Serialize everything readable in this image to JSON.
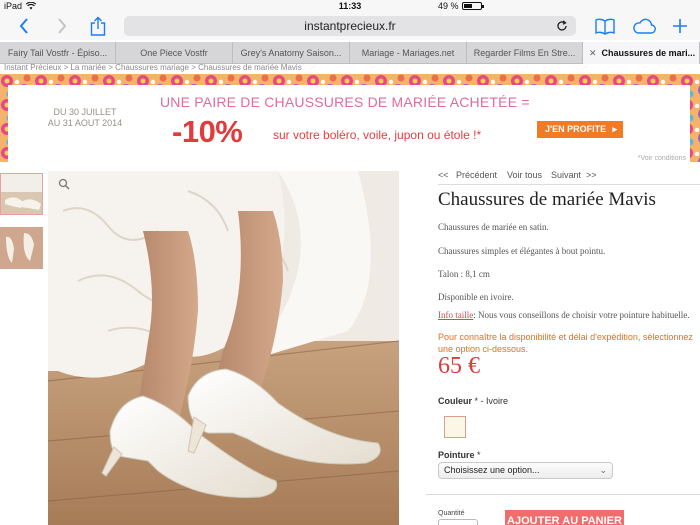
{
  "status_bar": {
    "device": "iPad",
    "time": "11:33",
    "battery": "49 %",
    "battery_level": 0.49
  },
  "toolbar": {
    "url": "instantprecieux.fr"
  },
  "tabs": [
    {
      "label": "Fairy Tail Vostfr - Épiso..."
    },
    {
      "label": "One Piece Vostfr"
    },
    {
      "label": "Grey's Anatomy Saison..."
    },
    {
      "label": "Mariage - Mariages.net"
    },
    {
      "label": "Regarder Films En Stre..."
    },
    {
      "label": "Chaussures de mari..."
    }
  ],
  "breadcrumb": "Instant Précieux > La mariée > Chaussures mariage > Chaussures de mariée Mavis",
  "banner": {
    "date_line1": "DU 30 JUILLET",
    "date_line2": "AU 31 AOUT 2014",
    "headline": "UNE PAIRE DE CHAUSSURES DE MARIÉE ACHETÉE =",
    "discount": "-10%",
    "subline": "sur votre boléro, voile, jupon ou étole !*",
    "cta": "J'EN PROFITE",
    "note": "*Voir conditions"
  },
  "product_nav": {
    "prev_arrows": "<<",
    "prev": "Précédent",
    "all": "Voir tous",
    "next": "Suivant",
    "next_arrows": ">>"
  },
  "product": {
    "title": "Chaussures de mariée Mavis",
    "desc1": "Chaussures de mariée en satin.",
    "desc2": "Chaussures simples et élégantes à bout pointu.",
    "heel": "Talon : 8,1 cm",
    "availability": "Disponible en ivoire.",
    "size_link": "Info taille",
    "size_text": ": Nous vous conseillons de choisir votre pointure habituelle.",
    "notice": "Pour connaître la disponibilité et délai d'expédition, sélectionnez une option ci-dessous.",
    "price": "65 €",
    "color_label": "Couleur",
    "color_value": "* - Ivoire",
    "size_label": "Pointure",
    "size_required": "*",
    "select_placeholder": "Choisissez une option...",
    "qty_label": "Quantité",
    "add_to_cart": "AJOUTER AU PANIER"
  },
  "colors": {
    "accent": "#f26c6c",
    "price": "#e03b3b",
    "ios_blue": "#1a7ef7",
    "swatch": "#fcf6e6"
  }
}
